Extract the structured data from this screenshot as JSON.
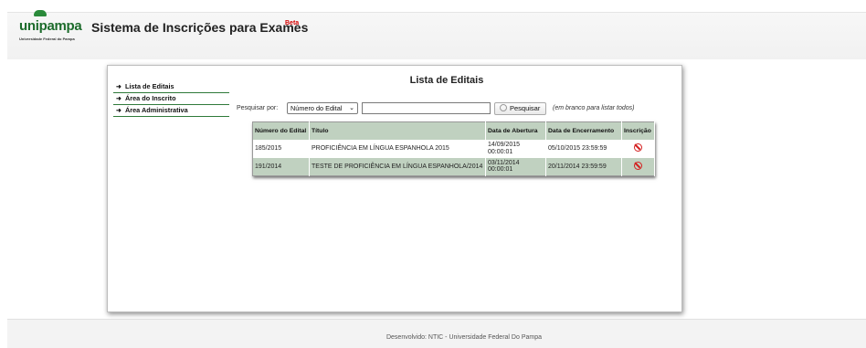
{
  "header": {
    "logo_word": "unipampa",
    "logo_sub": "Universidade Federal do Pampa",
    "title": "Sistema de Inscrições para Exames",
    "badge": "Beta"
  },
  "menu": {
    "items": [
      {
        "label": "Lista de Editais"
      },
      {
        "label": "Área do Inscrito"
      },
      {
        "label": "Área Administrativa"
      }
    ],
    "arrow": "➜"
  },
  "main": {
    "title": "Lista de Editais",
    "search": {
      "label": "Pesquisar por:",
      "select_value": "Número do Edital",
      "input_value": "",
      "button_label": "Pesquisar",
      "hint": "(em branco para listar todos)"
    },
    "table": {
      "headers": [
        "Número do Edital",
        "Título",
        "Data de Abertura",
        "Data de Encerramento",
        "Inscrição"
      ],
      "rows": [
        [
          "185/2015",
          "PROFICIÊNCIA EM LÍNGUA ESPANHOLA 2015",
          "14/09/2015 00:00:01",
          "05/10/2015 23:59:59",
          "ban-icon"
        ],
        [
          "191/2014",
          "TESTE DE PROFICIÊNCIA EM LÍNGUA ESPANHOLA/2014",
          "03/11/2014 00:00:01",
          "20/11/2014 23:59:59",
          "ban-icon"
        ]
      ]
    }
  },
  "footer": {
    "text": "Desenvolvido: NTIC - Universidade Federal Do Pampa"
  },
  "colors": {
    "brand_green": "#1c6b2b",
    "table_header": "#c0d1c0",
    "beta_red": "#d40000",
    "ban_red": "#d42020"
  }
}
